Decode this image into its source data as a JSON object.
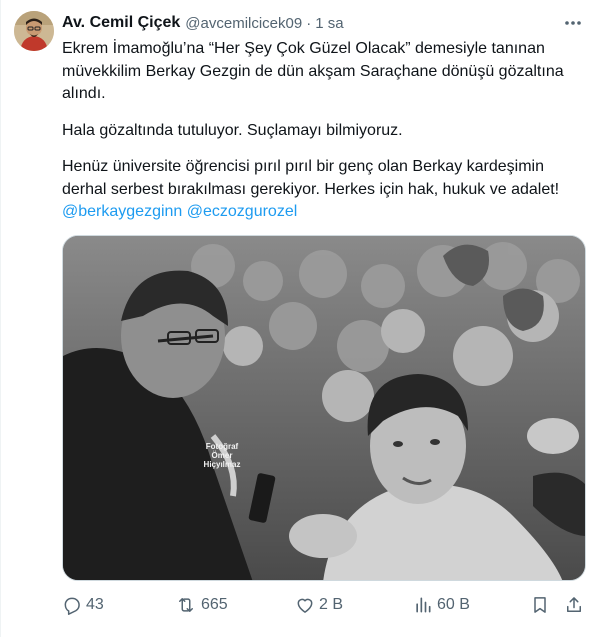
{
  "tweet": {
    "display_name": "Av. Cemil Çiçek",
    "handle": "@avcemilcicek09",
    "separator": "·",
    "time": "1 sa",
    "paragraphs": [
      "Ekrem İmamoğlu’na “Her Şey Çok Güzel Olacak” demesiyle tanınan müvekkilim Berkay Gezgin de dün akşam Saraçhane dönüşü gözaltına alındı.",
      "Hala gözaltında tutuluyor. Suçlamayı bilmiyoruz."
    ],
    "paragraph3_text": "Henüz üniversite öğrencisi pırıl pırıl bir genç olan Berkay kardeşimin derhal serbest bırakılması gerekiyor. Herkes için hak, hukuk ve adalet!",
    "mentions": [
      "@berkaygezginn",
      "@eczozgurozel"
    ],
    "media": {
      "watermark_line1": "Fotoğraf",
      "watermark_line2": "Ömer",
      "watermark_line3": "Hiçyılmaz"
    },
    "actions": {
      "replies": "43",
      "retweets": "665",
      "likes": "2 B",
      "views": "60 B"
    },
    "icons": {
      "avatar": "avatar",
      "more": "more-horizontal-icon",
      "reply": "reply-icon",
      "retweet": "retweet-icon",
      "like": "heart-icon",
      "views": "bar-chart-icon",
      "bookmark": "bookmark-icon",
      "share": "share-icon"
    },
    "colors": {
      "text": "#0f1419",
      "secondary": "#536471",
      "link": "#1d9bf0",
      "border": "#cfd9de"
    }
  }
}
